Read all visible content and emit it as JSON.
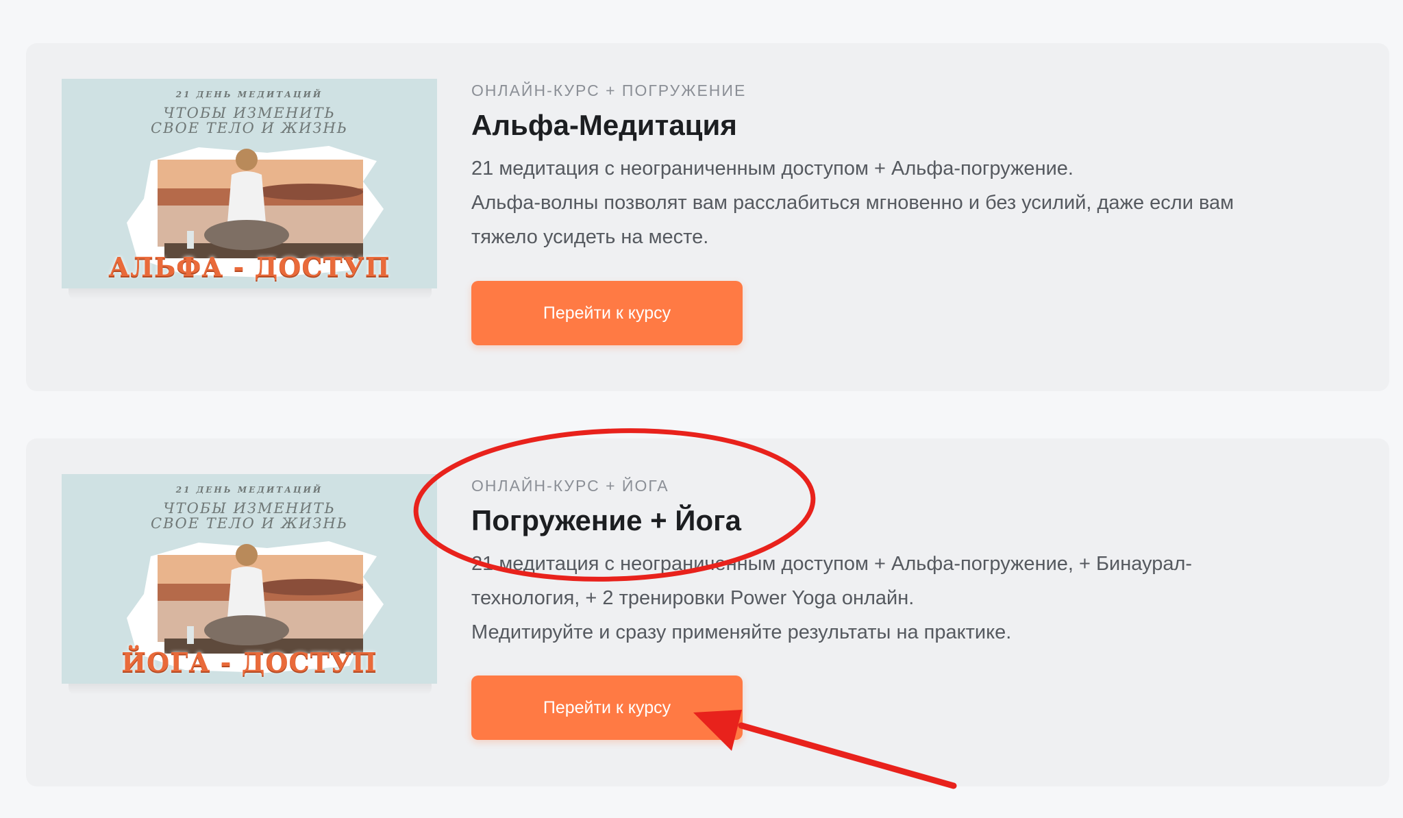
{
  "courses": [
    {
      "eyebrow": "ОНЛАЙН-КУРС + ПОГРУЖЕНИЕ",
      "title": "Альфа-Медитация",
      "description": [
        "21 медитация с неограниченным доступом + Альфа-погружение.",
        "Альфа-волны позволят вам расслабиться мгновенно и без усилий, даже если вам",
        "тяжело усидеть на месте."
      ],
      "button_label": "Перейти к курсу",
      "thumbnail": {
        "line1": "21 ДЕНЬ МЕДИТАЦИЙ",
        "line2": "ЧТОБЫ ИЗМЕНИТЬ",
        "line3": "СВОЕ ТЕЛО И ЖИЗНЬ",
        "badge": "АЛЬФА - ДОСТУП"
      }
    },
    {
      "eyebrow": "ОНЛАЙН-КУРС + ЙОГА",
      "title": "Погружение + Йога",
      "description": [
        "21 медитация с неограниченным доступом + Альфа-погружение, + Бинаурал-",
        "технология, + 2 тренировки Power Yoga онлайн.",
        "Медитируйте и сразу применяйте результаты на практике."
      ],
      "button_label": "Перейти к курсу",
      "thumbnail": {
        "line1": "21 ДЕНЬ МЕДИТАЦИЙ",
        "line2": "ЧТОБЫ ИЗМЕНИТЬ",
        "line3": "СВОЕ ТЕЛО И ЖИЗНЬ",
        "badge": "ЙОГА - ДОСТУП"
      }
    }
  ],
  "colors": {
    "accent": "#ff7a44",
    "annotation": "#e8221c",
    "card_bg": "#eff0f2",
    "page_bg": "#f6f7f9"
  },
  "annotations": {
    "highlight_shape": "ellipse",
    "pointer_shape": "arrow"
  }
}
